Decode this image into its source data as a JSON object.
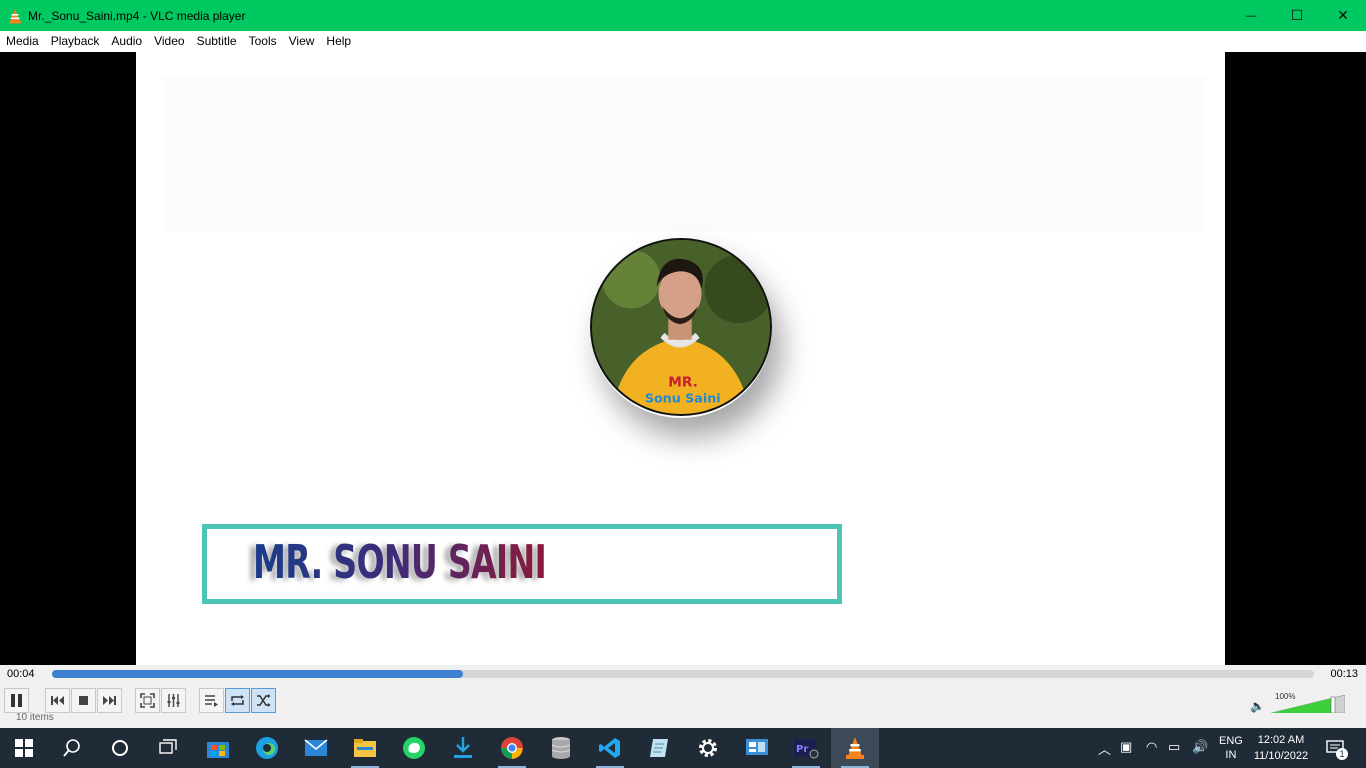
{
  "window": {
    "title": "Mr._Sonu_Saini.mp4 - VLC media player",
    "minimize_glyph": "—",
    "maximize_glyph": "☐",
    "close_glyph": "✕"
  },
  "menu": {
    "items": [
      "Media",
      "Playback",
      "Audio",
      "Video",
      "Subtitle",
      "Tools",
      "View",
      "Help"
    ]
  },
  "video": {
    "name_overlay": "MR. SONU SAINI",
    "hoodie_text_1": "MR.",
    "hoodie_text_2": "Sonu Saini"
  },
  "playback": {
    "current_time": "00:04",
    "total_time": "00:13",
    "progress_percent": 32.6
  },
  "volume": {
    "label": "100%",
    "level_percent": 100
  },
  "status": {
    "text": "10 items"
  },
  "taskbar": {
    "icons": [
      "windows-start-icon",
      "search-icon",
      "cortana-icon",
      "task-view-icon",
      "microsoft-store-icon",
      "edge-icon",
      "mail-icon",
      "file-explorer-icon",
      "whatsapp-icon",
      "downloader-icon",
      "chrome-icon",
      "database-icon",
      "vscode-icon",
      "notepad-icon",
      "settings-icon",
      "control-panel-icon",
      "video-editor-icon",
      "vlc-icon"
    ],
    "lang_line1": "ENG",
    "lang_line2": "IN",
    "time": "12:02 AM",
    "date": "11/10/2022",
    "notification_count": "1"
  }
}
